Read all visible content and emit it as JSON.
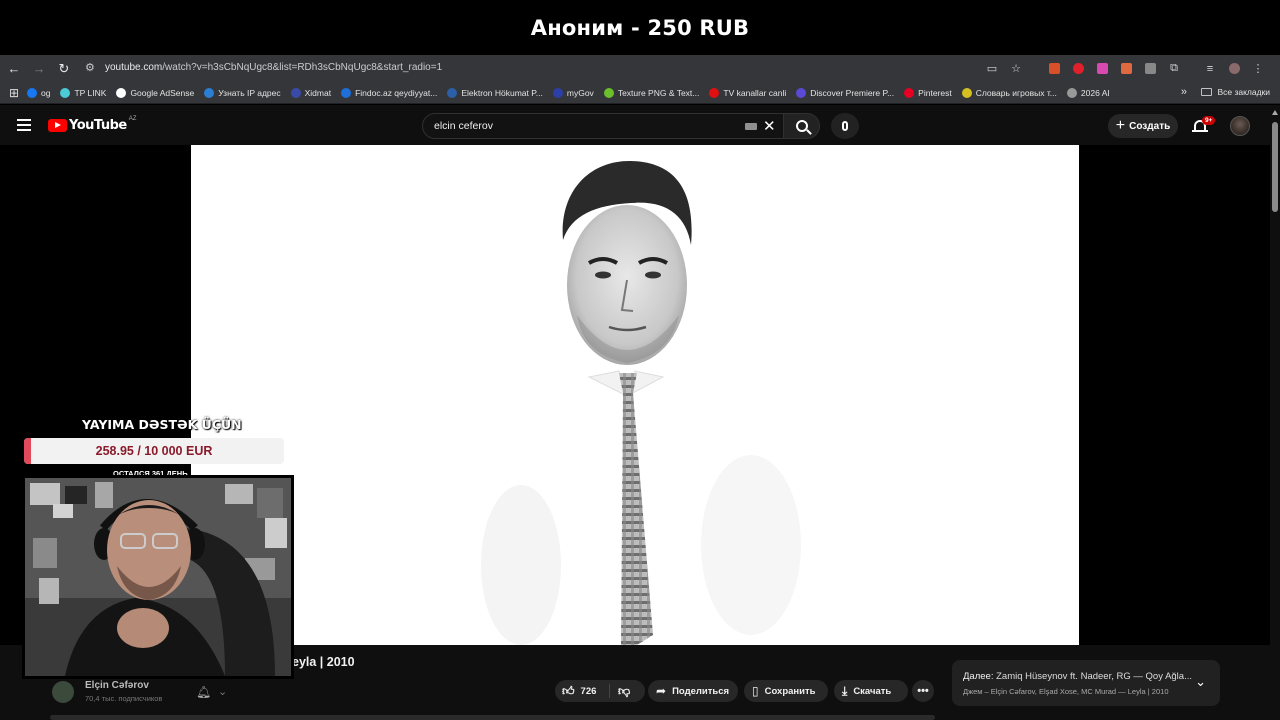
{
  "alert": {
    "text": "Аноним - 250 RUB"
  },
  "browser": {
    "url_domain": "youtube.com",
    "url_path": "/watch?v=h3sCbNqUgc8&list=RDh3sCbNqUgc8&start_radio=1",
    "bookmarks": [
      {
        "label": "og",
        "color": "#1877f2"
      },
      {
        "label": "TP LINK",
        "color": "#4acbd6"
      },
      {
        "label": "Google AdSense",
        "color": "#ffffff"
      },
      {
        "label": "Узнать IP адрес",
        "color": "#2a7fd4"
      },
      {
        "label": "Xidmat",
        "color": "#3a4aa8"
      },
      {
        "label": "Findoc.az qeydiyyat...",
        "color": "#1e6fd9"
      },
      {
        "label": "Elektron Hökumat P...",
        "color": "#2b5fa8"
      },
      {
        "label": "myGov",
        "color": "#2b3fa8"
      },
      {
        "label": "Texture PNG & Text...",
        "color": "#6abf2a"
      },
      {
        "label": "TV kanallar canli",
        "color": "#e01010"
      },
      {
        "label": "Discover Premiere P...",
        "color": "#5a4ad6"
      },
      {
        "label": "Pinterest",
        "color": "#e60023"
      },
      {
        "label": "Словарь игровых т...",
        "color": "#d4c020"
      },
      {
        "label": "2026 AI",
        "color": "#999999"
      }
    ],
    "all_bookmarks": "Все закладки"
  },
  "youtube": {
    "logo_text": "YouTube",
    "country": "AZ",
    "search_value": "elcin ceferov",
    "create_label": "Создать",
    "notif_badge": "9+"
  },
  "video": {
    "title_visible": "eyla | 2010",
    "channel_name": "Elçin Cəfərov",
    "subscribers": "70,4 тыс. подписчиков",
    "likes": "726",
    "share_label": "Поделиться",
    "save_label": "Сохранить",
    "download_label": "Скачать"
  },
  "up_next": {
    "prefix": "Далее:",
    "title": "Zamiq Hüseynov ft. Nadeer, RG — Qoy Ağla...",
    "subtitle": "Джем – Elçin Cəfarov, Elşad Xose, MC Murad — Leyla | 2010"
  },
  "overlay": {
    "goal_title": "YAYIMA DƏSTƏK ÜÇÜN",
    "goal_amount": "258.95 / 10 000 EUR",
    "goal_progress": 0.025895,
    "days_left": "ОСТАЛСЯ 361 ДЕНЬ"
  },
  "colors": {
    "accent_red": "#ff0000",
    "goal_fill": "#e04a5a"
  }
}
